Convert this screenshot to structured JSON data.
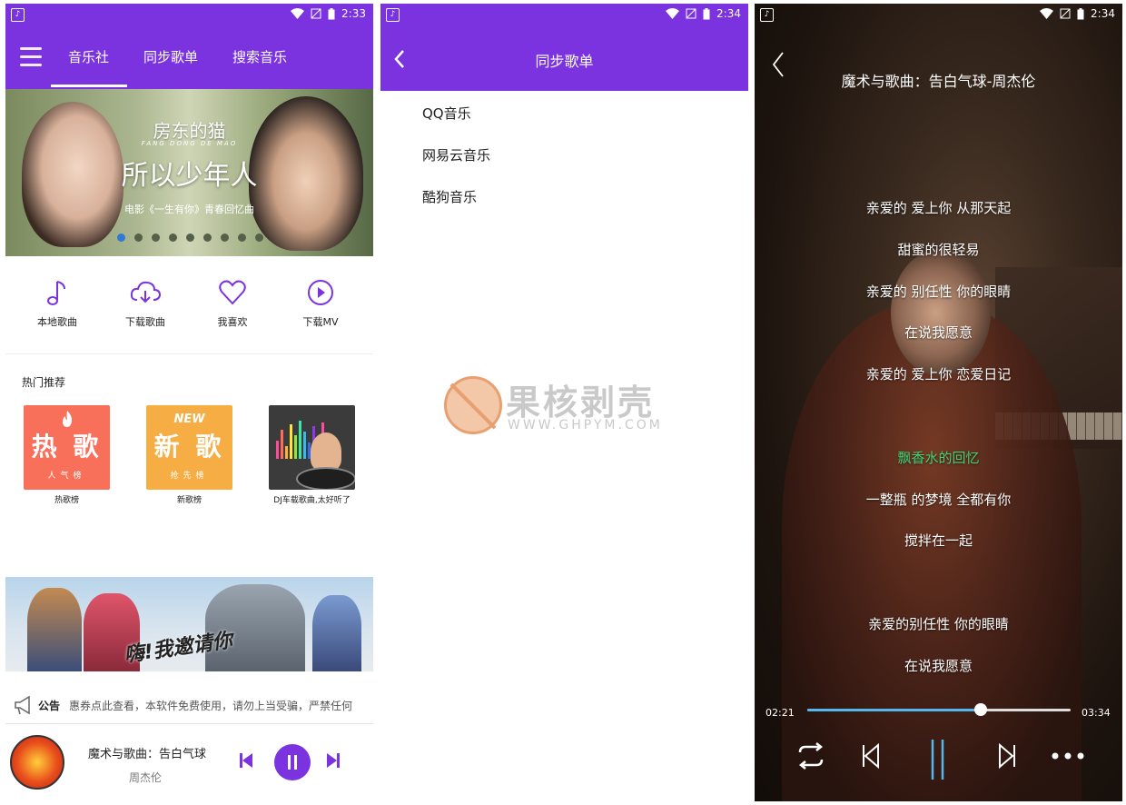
{
  "status": {
    "app_glyph": "♪",
    "time_1": "2:33",
    "time_2": "2:34",
    "time_3": "2:34"
  },
  "music_home": {
    "tabs": [
      "音乐社",
      "同步歌单",
      "搜索音乐"
    ],
    "active_tab": 0,
    "banner": {
      "title": "房东的猫",
      "subtitle_en": "FANG DONG DE MAO",
      "headline": "所以少年人",
      "caption": "电影《一生有你》青春回忆曲",
      "dot_count": 9,
      "active_dot": 0
    },
    "quick_actions": [
      {
        "label": "本地歌曲",
        "icon": "music-note-icon"
      },
      {
        "label": "下载歌曲",
        "icon": "cloud-download-icon"
      },
      {
        "label": "我喜欢",
        "icon": "heart-icon"
      },
      {
        "label": "下载MV",
        "icon": "play-circle-icon"
      }
    ],
    "section_title": "热门推荐",
    "recommend": [
      {
        "cover_big": "热 歌",
        "cover_small": "人气榜",
        "caption": "热歌榜"
      },
      {
        "cover_tag": "NEW",
        "cover_big": "新 歌",
        "cover_small": "抢先榜",
        "caption": "新歌榜"
      },
      {
        "caption": "DJ车载歌曲,太好听了"
      }
    ],
    "ad_banner": {
      "slogan": "嗨!我邀请你"
    },
    "notice": {
      "label": "公告",
      "text": "惠券点此查看，本软件免费使用，请勿上当受骗，严禁任何"
    },
    "now_playing": {
      "title": "魔术与歌曲：告白气球",
      "artist": "周杰伦"
    }
  },
  "sync_playlist": {
    "title": "同步歌单",
    "platforms": [
      "QQ音乐",
      "网易云音乐",
      "酷狗音乐"
    ],
    "watermark": {
      "name": "果核剥壳",
      "url": "WWW.GHPYM.COM"
    }
  },
  "lyrics_player": {
    "title": "魔术与歌曲：告白气球-周杰伦",
    "lines": [
      "亲爱的 爱上你 从那天起",
      "甜蜜的很轻易",
      "亲爱的 别任性 你的眼睛",
      "在说我愿意",
      "亲爱的 爱上你 恋爱日记",
      "",
      "飘香水的回忆",
      "一整瓶 的梦境 全都有你",
      "搅拌在一起",
      "",
      "亲爱的别任性 你的眼睛",
      "在说我愿意"
    ],
    "current_line": 6,
    "elapsed": "02:21",
    "duration": "03:34",
    "progress": 0.66,
    "colors": {
      "accent": "#7a33de",
      "current_lyric": "#3fd476",
      "progress": "#54b8ec"
    }
  }
}
